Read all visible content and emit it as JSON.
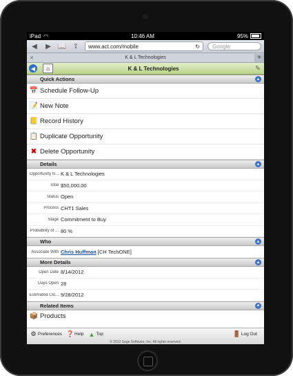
{
  "statusbar": {
    "carrier": "iPad",
    "time": "10:46 AM",
    "battery": "95%"
  },
  "browser": {
    "url": "www.act.com/mobile",
    "search_placeholder": "Google",
    "tab_title": "K & L Technologies"
  },
  "app": {
    "title": "K & L Technologies"
  },
  "quick_actions": {
    "header": "Quick Actions",
    "items": [
      {
        "label": "Schedule Follow-Up",
        "icon": "calendar-icon"
      },
      {
        "label": "New Note",
        "icon": "note-icon"
      },
      {
        "label": "Record History",
        "icon": "history-icon"
      },
      {
        "label": "Duplicate Opportunity",
        "icon": "duplicate-icon"
      },
      {
        "label": "Delete Opportunity",
        "icon": "delete-icon"
      }
    ]
  },
  "details": {
    "header": "Details",
    "rows": [
      {
        "label": "Opportunity N...",
        "value": "K & L Technologies"
      },
      {
        "label": "Total",
        "value": "$50,000.00"
      },
      {
        "label": "Status",
        "value": "Open"
      },
      {
        "label": "Process",
        "value": "CHT1 Sales"
      },
      {
        "label": "Stage",
        "value": "Commitment to Buy"
      },
      {
        "label": "Probability of ...",
        "value": "80 %"
      }
    ]
  },
  "who": {
    "header": "Who",
    "label": "Associate With",
    "contact": "Chris Huffman",
    "company": "[CH TechONE]"
  },
  "more_details": {
    "header": "More Details",
    "rows": [
      {
        "label": "Open Date",
        "value": "8/14/2012"
      },
      {
        "label": "Days Open",
        "value": "28"
      },
      {
        "label": "Estimated Clo...",
        "value": "9/28/2012"
      }
    ]
  },
  "related": {
    "header": "Related Items",
    "products": "Products"
  },
  "footer": {
    "preferences": "Preferences",
    "help": "Help",
    "top": "Top",
    "logout": "Log Out",
    "copyright": "© 2012 Sage Software, Inc. All rights reserved."
  }
}
